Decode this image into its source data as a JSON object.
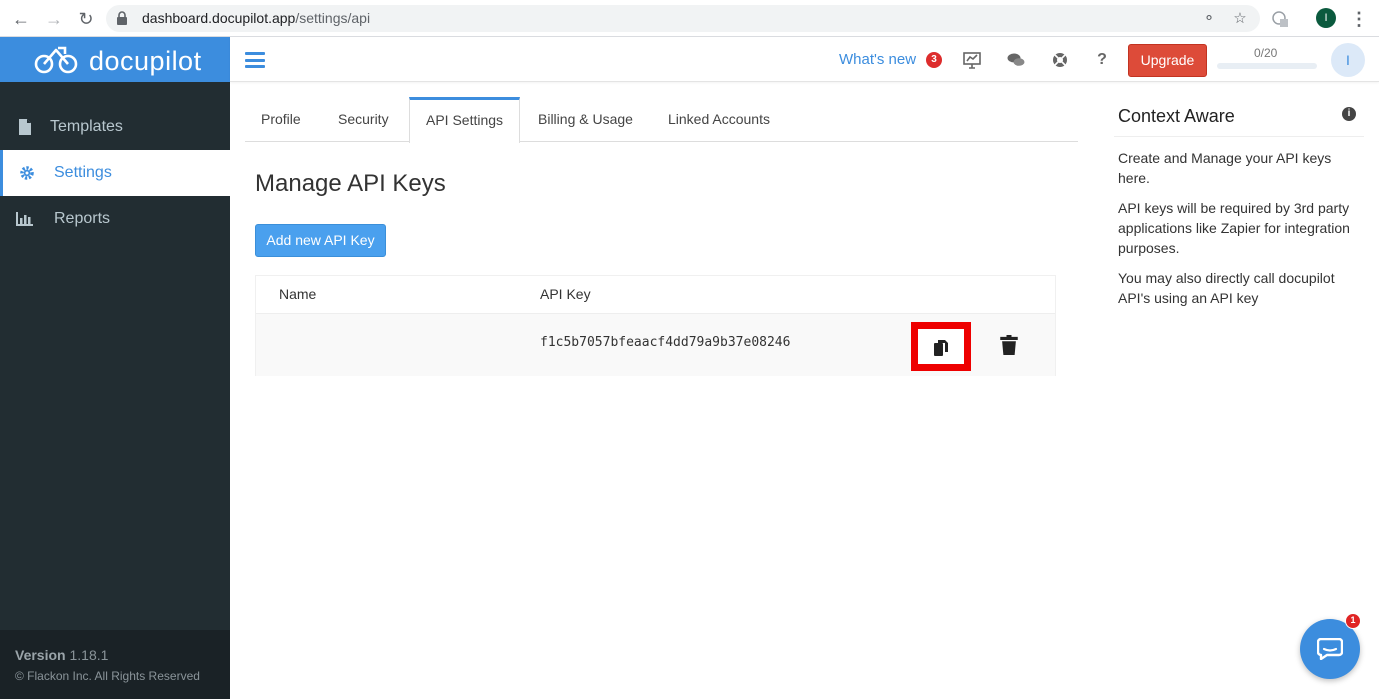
{
  "browser": {
    "url_domain": "dashboard.docupilot.app",
    "url_path": "/settings/api",
    "profile_initial": "I"
  },
  "brand": {
    "name": "docupilot",
    "color": "#3c8dde"
  },
  "sidebar": {
    "items": [
      {
        "label": "Templates",
        "icon": "file-icon",
        "active": false
      },
      {
        "label": "Settings",
        "icon": "gear-icon",
        "active": true
      },
      {
        "label": "Reports",
        "icon": "bar-chart-icon",
        "active": false
      }
    ],
    "version_label": "Version",
    "version_number": "1.18.1",
    "copyright": "© Flackon Inc. All Rights Reserved"
  },
  "header": {
    "whats_new": "What's new",
    "whats_new_count": "3",
    "upgrade_label": "Upgrade",
    "usage": "0/20",
    "usage_fraction": 0,
    "avatar_initial": "I"
  },
  "tabs": [
    {
      "label": "Profile",
      "active": false
    },
    {
      "label": "Security",
      "active": false
    },
    {
      "label": "API Settings",
      "active": true
    },
    {
      "label": "Billing & Usage",
      "active": false
    },
    {
      "label": "Linked Accounts",
      "active": false
    }
  ],
  "main": {
    "title": "Manage API Keys",
    "add_button": "Add new API Key",
    "table": {
      "columns": [
        "Name",
        "API Key"
      ],
      "rows": [
        {
          "name": "",
          "api_key": "f1c5b7057bfeaacf4dd79a9b37e08246"
        }
      ]
    }
  },
  "context": {
    "title": "Context Aware",
    "paragraphs": [
      "Create and Manage your API keys here.",
      "API keys will be required by 3rd party applications like Zapier for integration purposes.",
      "You may also directly call docupilot API's using an API key"
    ]
  },
  "chat": {
    "unread_count": "1"
  }
}
